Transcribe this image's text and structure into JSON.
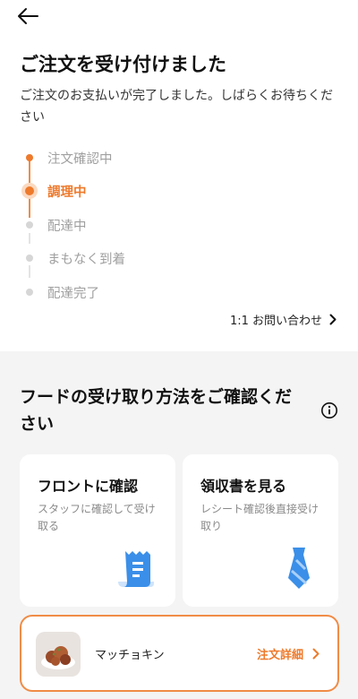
{
  "header": {
    "back_icon": "arrow-left-icon",
    "title": "ご注文を受け付けました",
    "subtitle": "ご注文のお支払いが完了しました。しばらくお待ちください"
  },
  "progress": {
    "steps": [
      {
        "label": "注文確認中",
        "state": "done"
      },
      {
        "label": "調理中",
        "state": "current"
      },
      {
        "label": "配達中",
        "state": "pending"
      },
      {
        "label": "まもなく到着",
        "state": "pending"
      },
      {
        "label": "配達完了",
        "state": "pending"
      }
    ]
  },
  "inquiry": {
    "label": "1:1 お問い合わせ",
    "icon": "chevron-right-icon"
  },
  "pickup": {
    "title": "フードの受け取り方法をご確認ください",
    "info_icon": "info-icon",
    "options": [
      {
        "title": "フロントに確認",
        "description": "スタッフに確認して受け取る",
        "icon": "receipt-icon"
      },
      {
        "title": "領収書を見る",
        "description": "レシート確認後直接受け取り",
        "icon": "necktie-icon"
      }
    ]
  },
  "order": {
    "item_name": "マッチョキン",
    "details_label": "注文詳細",
    "thumb_icon": "fried-chicken-image",
    "chevron_icon": "chevron-right-icon"
  },
  "colors": {
    "accent": "#ee7a2c",
    "accent_light": "#fbd9c0",
    "inactive": "#d6d6d6",
    "illustration_blue": "#3b8fe8"
  }
}
